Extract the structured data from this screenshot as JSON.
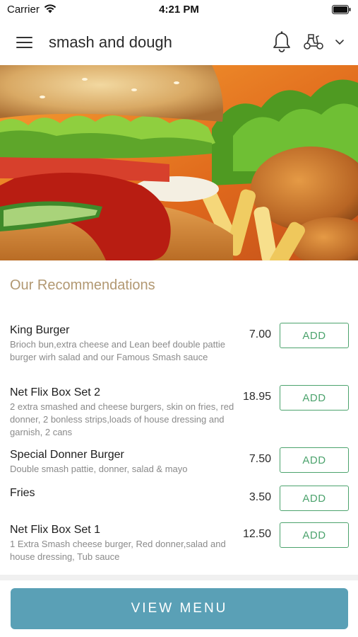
{
  "status_bar": {
    "carrier": "Carrier",
    "time": "4:21 PM"
  },
  "header": {
    "title": "smash and dough",
    "icons": [
      "menu-icon",
      "bell-icon",
      "scooter-icon",
      "chevron-down-icon"
    ]
  },
  "section": {
    "title": "Our Recommendations"
  },
  "colors": {
    "accent_green": "#4ca36d",
    "section_title": "#b29872",
    "view_menu_bg": "#5aa0b6"
  },
  "items": [
    {
      "name": "King Burger",
      "description": "Brioch bun,extra cheese and Lean beef double pattie burger wirh salad and our Famous Smash sauce",
      "price": "7.00",
      "action": "ADD"
    },
    {
      "name": "Net Flix Box Set 2",
      "description": "2 extra smashed and cheese burgers, skin on fries, red donner, 2 bonless strips,loads of house dressing and garnish, 2 cans",
      "price": "18.95",
      "action": "ADD"
    },
    {
      "name": "Special Donner Burger",
      "description": "Double smash pattie, donner, salad & mayo",
      "price": "7.50",
      "action": "ADD"
    },
    {
      "name": "Fries",
      "description": "",
      "price": "3.50",
      "action": "ADD"
    },
    {
      "name": "Net Flix Box Set 1",
      "description": "1 Extra Smash cheese burger, Red donner,salad and house dressing, Tub sauce",
      "price": "12.50",
      "action": "ADD"
    }
  ],
  "footer": {
    "view_menu_label": "VIEW MENU"
  }
}
